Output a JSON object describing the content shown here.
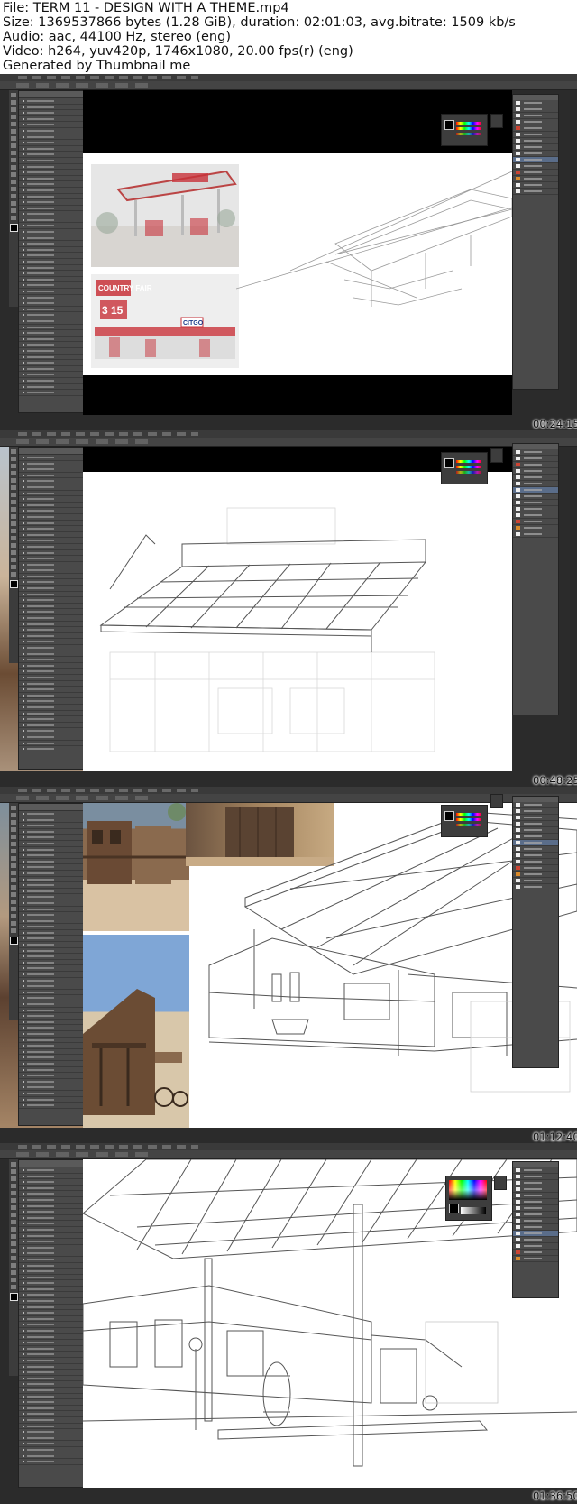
{
  "header": {
    "file": "File: TERM 11 - DESIGN WITH A THEME.mp4",
    "size": "Size: 1369537866 bytes (1.28 GiB), duration: 02:01:03, avg.bitrate: 1509 kb/s",
    "audio": "Audio: aac, 44100 Hz, stereo (eng)",
    "video": "Video: h264, yuv420p, 1746x1080, 20.00 fps(r) (eng)",
    "generated": "Generated by Thumbnail me"
  },
  "frames": [
    {
      "timestamp": "00:24:15",
      "reference_text_1": "COUNTRY FAIR",
      "reference_text_2": "3 15",
      "reference_text_3": "CITGO"
    },
    {
      "timestamp": "00:48:25"
    },
    {
      "timestamp": "01:12:40"
    },
    {
      "timestamp": "01:36:50"
    }
  ],
  "colors": {
    "app_background": "#2b2b2b",
    "panel": "#4a4a4a",
    "canvas": "#ffffff",
    "sketch_line": "#555555",
    "station_red": "#c8323a"
  },
  "icons": [
    "tool-icons",
    "color-swatch",
    "layer-thumbnails"
  ]
}
